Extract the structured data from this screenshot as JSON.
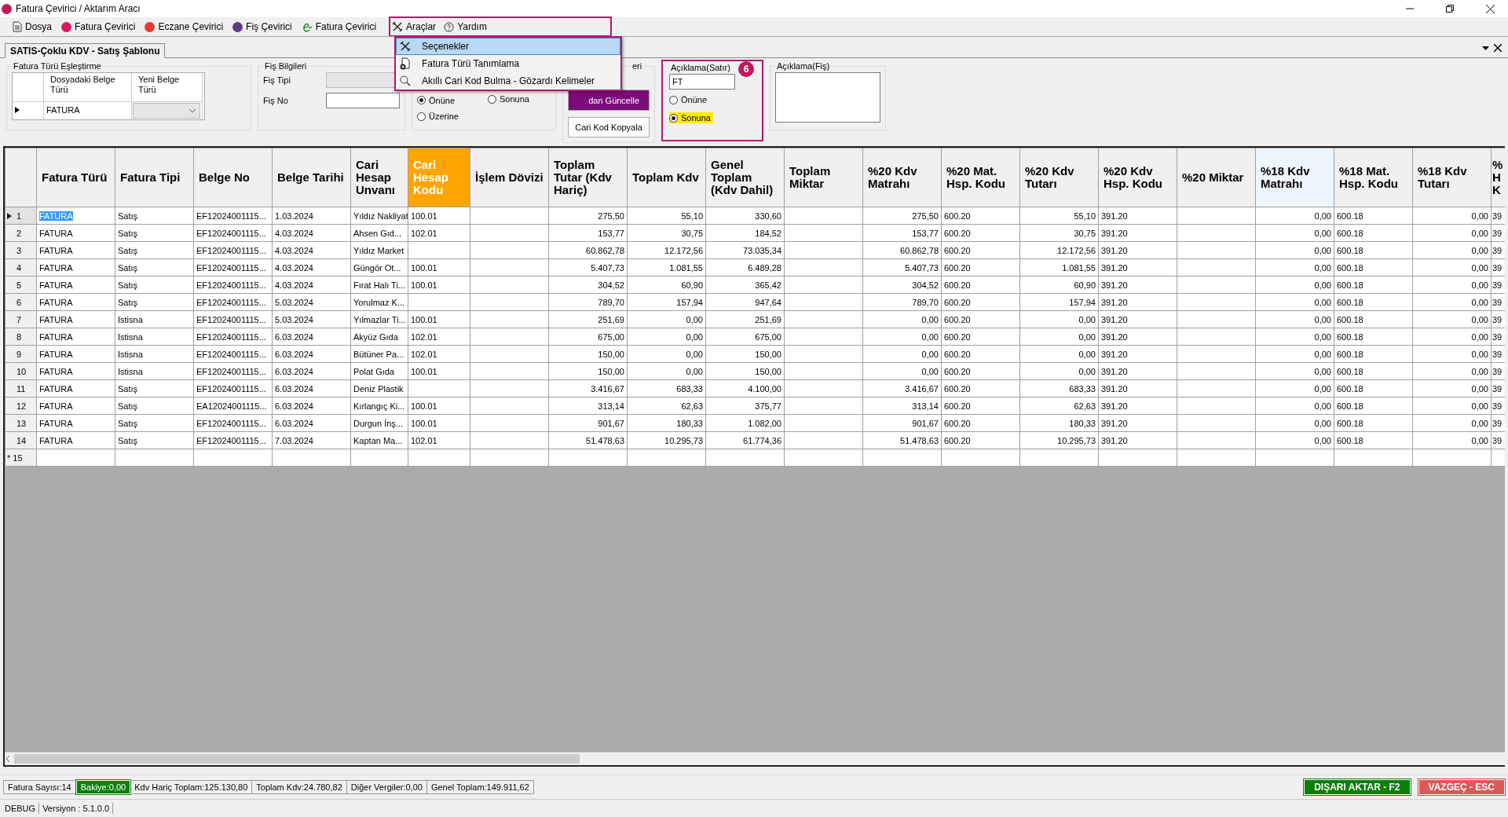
{
  "window": {
    "title": "Fatura Çevirici / Aktarım Aracı"
  },
  "menu": [
    {
      "label": "Dosya",
      "highlighted": false
    },
    {
      "label": "Fatura Çevirici",
      "highlighted": false
    },
    {
      "label": "Eczane Çevirici",
      "highlighted": false
    },
    {
      "label": "Fiş Çevirici",
      "highlighted": false
    },
    {
      "label": "Fatura Çevirici",
      "highlighted": false
    },
    {
      "label": "Araçlar",
      "highlighted": true
    },
    {
      "label": "Yardım",
      "highlighted": false
    }
  ],
  "dropdown": [
    {
      "label": "Seçenekler",
      "selected": true
    },
    {
      "label": "Fatura Türü Tanımlama",
      "selected": false
    },
    {
      "label": "Akıllı Cari Kod Bulma - Gözardı Kelimeler",
      "selected": false
    }
  ],
  "tab": {
    "label": "SATIS-Çoklu KDV - Satış Şablonu",
    "selected": true
  },
  "type_mapping": {
    "title": "Fatura Türü Eşleştirme",
    "columns": [
      "Dosyadaki Belge Türü",
      "Yeni Belge Türü"
    ],
    "row": {
      "value": "FATURA"
    }
  },
  "slip_info": {
    "title": "Fiş Bilgileri",
    "fields": [
      {
        "label": "Fiş Tipi",
        "kind": "combo",
        "disabled": true
      },
      {
        "label": "Fiş No",
        "kind": "text",
        "disabled": false
      }
    ]
  },
  "position_group": {
    "options": [
      {
        "label": "Önüne",
        "selected": true
      },
      {
        "label": "Sonuna",
        "selected": false
      },
      {
        "label": "Üzerine",
        "selected": false
      }
    ]
  },
  "actions_group": {
    "title": "eri",
    "buttons": [
      {
        "label": "dan Güncelle",
        "kind": "primary"
      },
      {
        "label": "Cari Kod Kopyala",
        "kind": "normal"
      }
    ]
  },
  "line_note": {
    "title": "Açıklama(Satır)",
    "badge": "6",
    "value": "FT",
    "options": [
      {
        "label": "Önüne",
        "selected": false
      },
      {
        "label": "Sonuna",
        "selected": true
      }
    ]
  },
  "slip_note": {
    "title": "Açıklama(Fiş)"
  },
  "table": {
    "columns": [
      {
        "label": "Fatura Türü",
        "kind": "text"
      },
      {
        "label": "Fatura Tipi",
        "kind": "text"
      },
      {
        "label": "Belge No",
        "kind": "text"
      },
      {
        "label": "Belge Tarihi",
        "kind": "text"
      },
      {
        "label": "Cari Hesap Unvanı",
        "kind": "text"
      },
      {
        "label": "Cari Hesap Kodu",
        "kind": "key"
      },
      {
        "label": "İşlem Dövizi",
        "kind": "text"
      },
      {
        "label": "Toplam Tutar (Kdv Hariç)",
        "kind": "amount"
      },
      {
        "label": "Toplam Kdv",
        "kind": "amount"
      },
      {
        "label": "Genel Toplam (Kdv Dahil)",
        "kind": "amount"
      },
      {
        "label": "Toplam Miktar",
        "kind": "amount"
      },
      {
        "label": "%20 Kdv Matrahı",
        "kind": "amount"
      },
      {
        "label": "%20 Mat. Hsp. Kodu",
        "kind": "text"
      },
      {
        "label": "%20 Kdv Tutarı",
        "kind": "amount"
      },
      {
        "label": "%20 Kdv Hsp. Kodu",
        "kind": "text"
      },
      {
        "label": "%20 Miktar",
        "kind": "amount"
      },
      {
        "label": "%18 Kdv Matrahı",
        "kind": "vat18"
      },
      {
        "label": "%18 Mat. Hsp. Kodu",
        "kind": "text"
      },
      {
        "label": "%18 Kdv Tutarı",
        "kind": "amount"
      },
      {
        "label": "% H K",
        "kind": "cut"
      }
    ],
    "rows": [
      {
        "number": "1",
        "selected": true,
        "cells": [
          "FATURA",
          "Satış",
          "EF12024001115...",
          "1.03.2024",
          "Yıldız Nakliyat",
          "100.01",
          "",
          "275,50",
          "55,10",
          "330,60",
          "",
          "275,50",
          "600.20",
          "55,10",
          "391.20",
          "",
          "0,00",
          "600.18",
          "0,00",
          "39"
        ]
      },
      {
        "number": "2",
        "selected": false,
        "cells": [
          "FATURA",
          "Satış",
          "EF12024001115...",
          "4.03.2024",
          "Ahsen Gıd...",
          "102.01",
          "",
          "153,77",
          "30,75",
          "184,52",
          "",
          "153,77",
          "600.20",
          "30,75",
          "391.20",
          "",
          "0,00",
          "600.18",
          "0,00",
          "39"
        ]
      },
      {
        "number": "3",
        "selected": false,
        "cells": [
          "FATURA",
          "Satış",
          "EF12024001115...",
          "4.03.2024",
          "Yıldız Market",
          "",
          "",
          "60.862,78",
          "12.172,56",
          "73.035,34",
          "",
          "60.862,78",
          "600.20",
          "12.172,56",
          "391.20",
          "",
          "0,00",
          "600.18",
          "0,00",
          "39"
        ]
      },
      {
        "number": "4",
        "selected": false,
        "cells": [
          "FATURA",
          "Satış",
          "EF12024001115...",
          "4.03.2024",
          "Güngör Ot...",
          "100.01",
          "",
          "5.407,73",
          "1.081,55",
          "6.489,28",
          "",
          "5.407,73",
          "600.20",
          "1.081,55",
          "391.20",
          "",
          "0,00",
          "600.18",
          "0,00",
          "39"
        ]
      },
      {
        "number": "5",
        "selected": false,
        "cells": [
          "FATURA",
          "Satış",
          "EF12024001115...",
          "4.03.2024",
          "Fırat Halı Ti...",
          "100.01",
          "",
          "304,52",
          "60,90",
          "365,42",
          "",
          "304,52",
          "600.20",
          "60,90",
          "391.20",
          "",
          "0,00",
          "600.18",
          "0,00",
          "39"
        ]
      },
      {
        "number": "6",
        "selected": false,
        "cells": [
          "FATURA",
          "Satış",
          "EF12024001115...",
          "5.03.2024",
          "Yorulmaz K...",
          "",
          "",
          "789,70",
          "157,94",
          "947,64",
          "",
          "789,70",
          "600.20",
          "157,94",
          "391.20",
          "",
          "0,00",
          "600.18",
          "0,00",
          "39"
        ]
      },
      {
        "number": "7",
        "selected": false,
        "cells": [
          "FATURA",
          "Istisna",
          "EF12024001115...",
          "5.03.2024",
          "Yılmazlar Ti...",
          "100.01",
          "",
          "251,69",
          "0,00",
          "251,69",
          "",
          "0,00",
          "600.20",
          "0,00",
          "391.20",
          "",
          "0,00",
          "600.18",
          "0,00",
          "39"
        ]
      },
      {
        "number": "8",
        "selected": false,
        "cells": [
          "FATURA",
          "Istisna",
          "EF12024001115...",
          "6.03.2024",
          "Akyüz Gıda",
          "102.01",
          "",
          "675,00",
          "0,00",
          "675,00",
          "",
          "0,00",
          "600.20",
          "0,00",
          "391.20",
          "",
          "0,00",
          "600.18",
          "0,00",
          "39"
        ]
      },
      {
        "number": "9",
        "selected": false,
        "cells": [
          "FATURA",
          "Istisna",
          "EF12024001115...",
          "6.03.2024",
          "Bütüner Pa...",
          "102.01",
          "",
          "150,00",
          "0,00",
          "150,00",
          "",
          "0,00",
          "600.20",
          "0,00",
          "391.20",
          "",
          "0,00",
          "600.18",
          "0,00",
          "39"
        ]
      },
      {
        "number": "10",
        "selected": false,
        "cells": [
          "FATURA",
          "Istisna",
          "EF12024001115...",
          "6.03.2024",
          "Polat Gıda",
          "100.01",
          "",
          "150,00",
          "0,00",
          "150,00",
          "",
          "0,00",
          "600.20",
          "0,00",
          "391.20",
          "",
          "0,00",
          "600.18",
          "0,00",
          "39"
        ]
      },
      {
        "number": "11",
        "selected": false,
        "cells": [
          "FATURA",
          "Satış",
          "EF12024001115...",
          "6.03.2024",
          "Deniz Plastik",
          "",
          "",
          "3.416,67",
          "683,33",
          "4.100,00",
          "",
          "3.416,67",
          "600.20",
          "683,33",
          "391.20",
          "",
          "0,00",
          "600.18",
          "0,00",
          "39"
        ]
      },
      {
        "number": "12",
        "selected": false,
        "cells": [
          "FATURA",
          "Satış",
          "EA12024001115...",
          "6.03.2024",
          "Kırlangıç Ki...",
          "100.01",
          "",
          "313,14",
          "62,63",
          "375,77",
          "",
          "313,14",
          "600.20",
          "62,63",
          "391.20",
          "",
          "0,00",
          "600.18",
          "0,00",
          "39"
        ]
      },
      {
        "number": "13",
        "selected": false,
        "cells": [
          "FATURA",
          "Satış",
          "EF12024001115...",
          "6.03.2024",
          "Durgun İnş...",
          "100.01",
          "",
          "901,67",
          "180,33",
          "1.082,00",
          "",
          "901,67",
          "600.20",
          "180,33",
          "391.20",
          "",
          "0,00",
          "600.18",
          "0,00",
          "39"
        ]
      },
      {
        "number": "14",
        "selected": false,
        "cells": [
          "FATURA",
          "Satış",
          "EF12024001115...",
          "7.03.2024",
          "Kaptan Ma...",
          "102.01",
          "",
          "51.478,63",
          "10.295,73",
          "61.774,36",
          "",
          "51.478,63",
          "600.20",
          "10.295,73",
          "391.20",
          "",
          "0,00",
          "600.18",
          "0,00",
          "39"
        ]
      }
    ],
    "new_row": {
      "marker": "*",
      "number": "15"
    }
  },
  "status_bar": [
    {
      "text": "Fatura Sayısı:14",
      "kind": "plain"
    },
    {
      "text": "Bakiye:0,00",
      "kind": "ok"
    },
    {
      "text": "Kdv Hariç Toplam:125.130,80",
      "kind": "plain"
    },
    {
      "text": "Toplam Kdv:24.780,82",
      "kind": "plain"
    },
    {
      "text": "Diğer Vergiler:0,00",
      "kind": "plain"
    },
    {
      "text": "Genel Toplam:149.911,62",
      "kind": "plain"
    }
  ],
  "actions": [
    {
      "label": "DIŞARI AKTAR - F2",
      "kind": "export"
    },
    {
      "label": "VAZGEÇ - ESC",
      "kind": "cancel"
    }
  ],
  "debug_bar": [
    "DEBUG",
    "Versiyon : 5.1.0.0"
  ]
}
